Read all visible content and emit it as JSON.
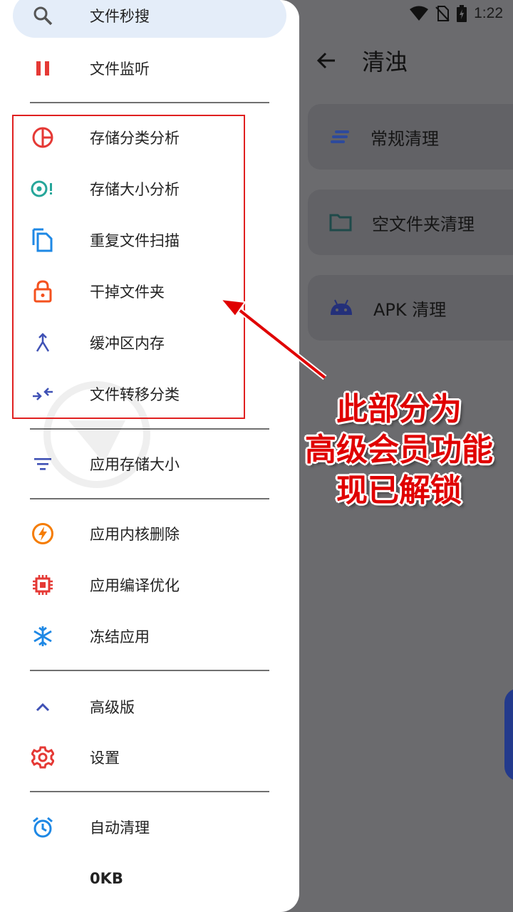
{
  "status_bar": {
    "time": "1:22"
  },
  "background_app": {
    "title": "清浊",
    "cards": [
      {
        "label": "常规清理",
        "icon": "lines-icon"
      },
      {
        "label": "空文件夹清理",
        "icon": "folder-icon"
      },
      {
        "label": "APK 清理",
        "icon": "android-icon"
      }
    ]
  },
  "drawer": {
    "items": [
      {
        "label": "文件秒搜",
        "icon": "search-icon",
        "color": "#555555"
      },
      {
        "label": "文件监听",
        "icon": "pause-icon",
        "color": "#e53935"
      },
      {
        "label": "存储分类分析",
        "icon": "pie-chart-icon",
        "color": "#e53935"
      },
      {
        "label": "存储大小分析",
        "icon": "target-icon",
        "color": "#26a69a"
      },
      {
        "label": "重复文件扫描",
        "icon": "copy-icon",
        "color": "#1e88e5"
      },
      {
        "label": "干掉文件夹",
        "icon": "lock-icon",
        "color": "#f4511e"
      },
      {
        "label": "缓冲区内存",
        "icon": "merge-icon",
        "color": "#3f51b5"
      },
      {
        "label": "文件转移分类",
        "icon": "transfer-icon",
        "color": "#3f51b5"
      },
      {
        "label": "应用存储大小",
        "icon": "filter-icon",
        "color": "#3f51b5"
      },
      {
        "label": "应用内核删除",
        "icon": "bolt-icon",
        "color": "#f57c00"
      },
      {
        "label": "应用编译优化",
        "icon": "chip-icon",
        "color": "#e53935"
      },
      {
        "label": "冻结应用",
        "icon": "snowflake-icon",
        "color": "#1e88e5"
      },
      {
        "label": "高级版",
        "icon": "chevron-up-icon",
        "color": "#3f51b5"
      },
      {
        "label": "设置",
        "icon": "gear-icon",
        "color": "#e53935"
      },
      {
        "label": "自动清理",
        "icon": "alarm-icon",
        "color": "#1e88e5"
      },
      {
        "label": "0KB",
        "icon": "",
        "color": ""
      }
    ]
  },
  "annotation": {
    "lines": [
      "此部分为",
      "高级会员功能",
      "现已解锁"
    ]
  }
}
